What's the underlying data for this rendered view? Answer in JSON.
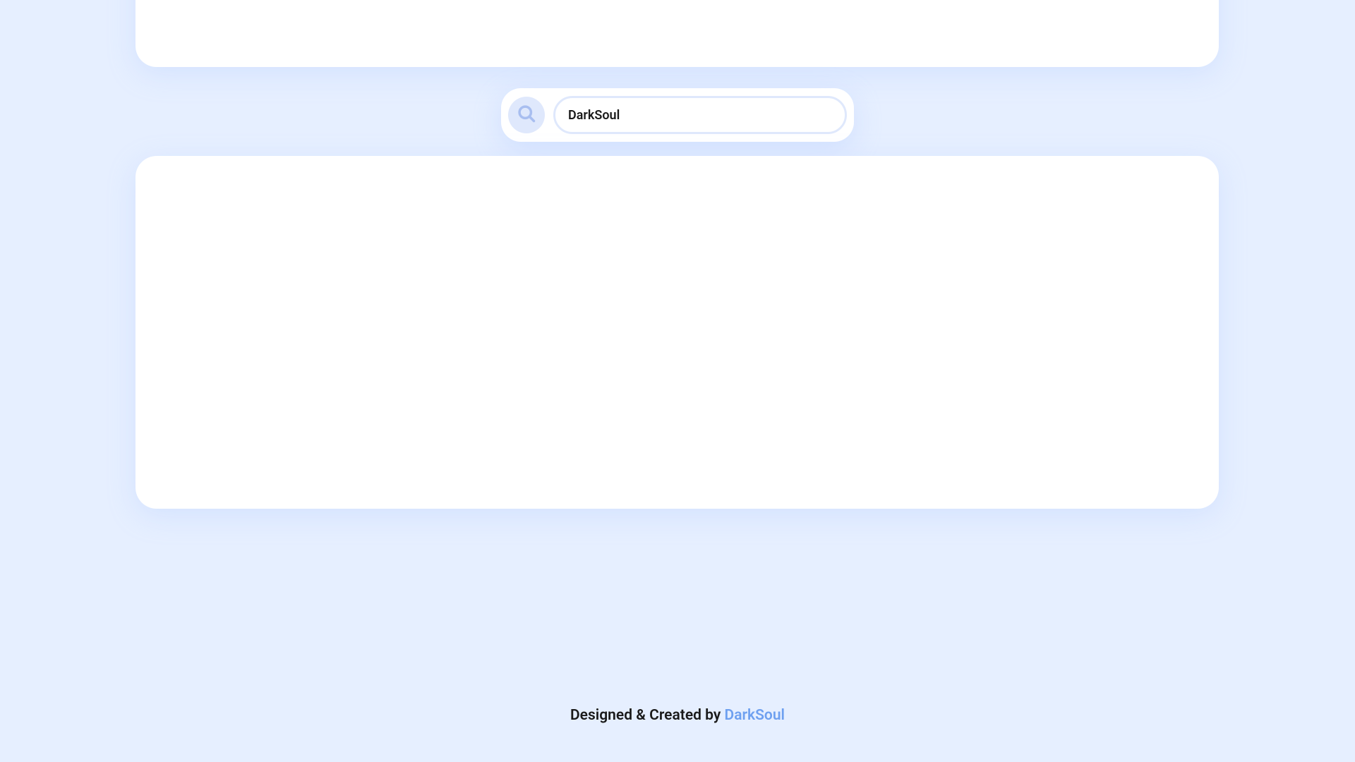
{
  "search": {
    "value": "DarkSoul",
    "placeholder": ""
  },
  "footer": {
    "prefix": "Designed & Created by ",
    "author": "DarkSoul"
  }
}
